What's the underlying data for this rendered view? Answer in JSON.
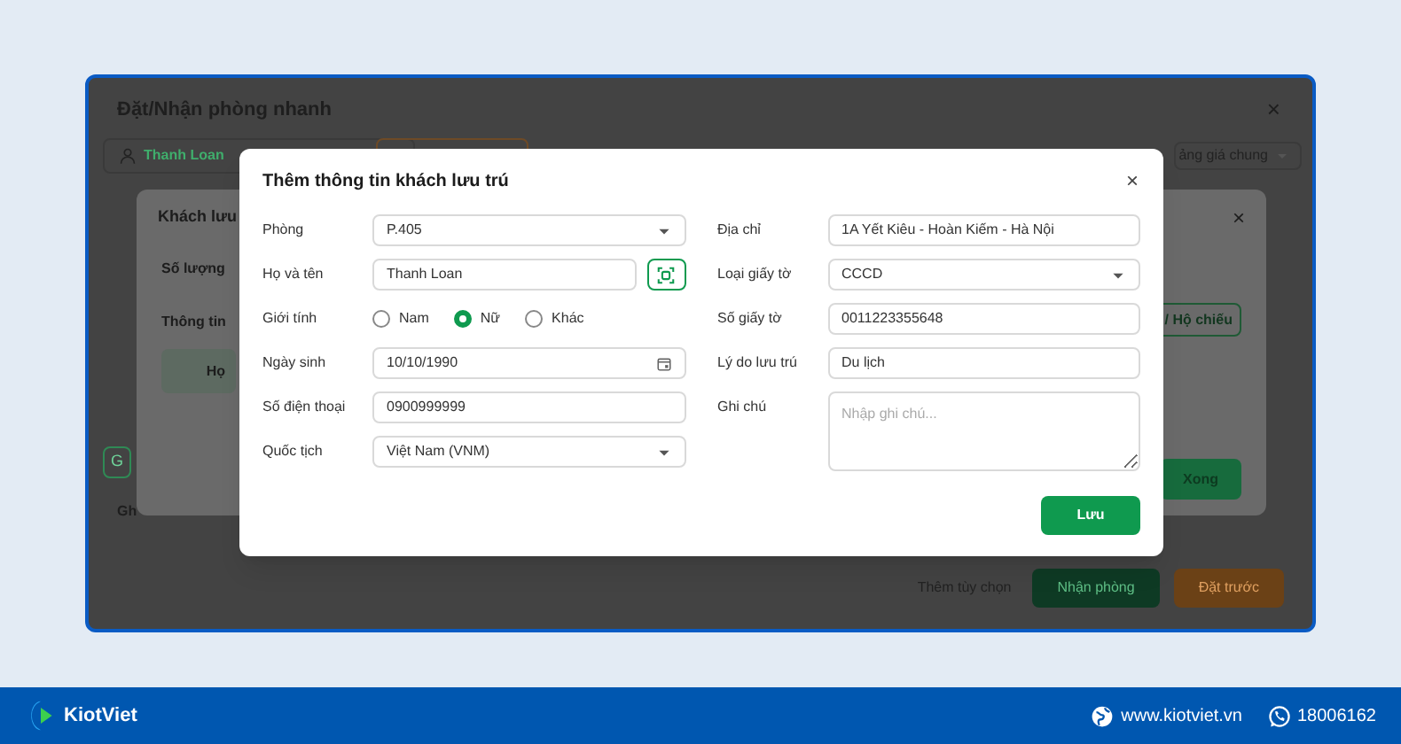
{
  "background_window": {
    "title": "Đặt/Nhận phòng nhanh",
    "close": "×",
    "guest_chip": "Thanh Loan",
    "price_list": "ảng giá chung",
    "side_chip": "G",
    "side_label": "Gh",
    "buttons": [
      {
        "label": "Thêm tùy chọn",
        "kind": "text"
      },
      {
        "label": "Nhận phòng",
        "kind": "primary"
      },
      {
        "label": "Đặt trước",
        "kind": "warning"
      }
    ]
  },
  "guest_list_dialog": {
    "title": "Khách lưu",
    "close": "×",
    "labels": [
      "Số lượng",
      "Thông tin"
    ],
    "table_header": "Họ",
    "id_button": "/ Hộ chiếu",
    "done_button": "Xong"
  },
  "dialog": {
    "title": "Thêm thông tin khách lưu trú",
    "close": "×",
    "left_fields": [
      {
        "label": "Phòng",
        "kind": "select",
        "value": "P.405"
      },
      {
        "label": "Họ và tên",
        "kind": "scan",
        "value": "Thanh Loan"
      },
      {
        "label": "Giới tính",
        "kind": "radio",
        "options": [
          {
            "label": "Nam",
            "selected": false
          },
          {
            "label": "Nữ",
            "selected": true
          },
          {
            "label": "Khác",
            "selected": false
          }
        ]
      },
      {
        "label": "Ngày sinh",
        "kind": "date",
        "value": "10/10/1990"
      },
      {
        "label": "Số điện thoại",
        "kind": "text",
        "value": "0900999999"
      },
      {
        "label": "Quốc tịch",
        "kind": "select",
        "value": "Việt Nam (VNM)"
      }
    ],
    "right_fields": [
      {
        "label": "Địa chỉ",
        "kind": "text",
        "value": "1A Yết Kiêu - Hoàn Kiếm - Hà Nội"
      },
      {
        "label": "Loại giấy tờ",
        "kind": "select",
        "value": "CCCD"
      },
      {
        "label": "Số giấy tờ",
        "kind": "text",
        "value": "0011223355648"
      },
      {
        "label": "Lý do lưu trú",
        "kind": "text",
        "value": "Du lịch"
      },
      {
        "label": "Ghi chú",
        "kind": "textarea",
        "placeholder": "Nhập ghi chú..."
      }
    ],
    "save_button": "Lưu"
  },
  "footer": {
    "brand": "KiotViet",
    "website": "www.kiotviet.vn",
    "hotline": "18006162"
  }
}
